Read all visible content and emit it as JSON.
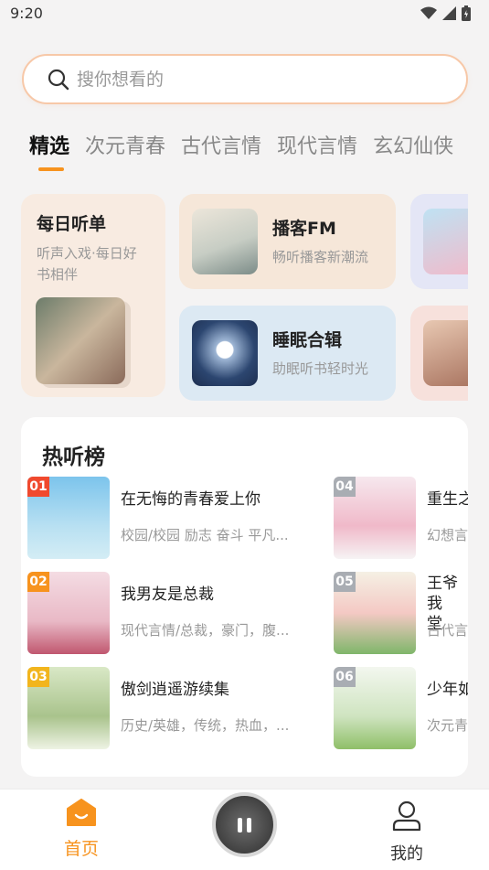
{
  "status_bar": {
    "time": "9:20",
    "icons": [
      "wifi-icon",
      "signal-icon",
      "battery-icon"
    ]
  },
  "search": {
    "placeholder": "搜你想看的",
    "icon": "search-icon"
  },
  "tabs": [
    {
      "label": "精选",
      "active": true
    },
    {
      "label": "次元青春",
      "active": false
    },
    {
      "label": "古代言情",
      "active": false
    },
    {
      "label": "现代言情",
      "active": false
    },
    {
      "label": "玄幻仙侠",
      "active": false
    }
  ],
  "featured": {
    "daily": {
      "title": "每日听单",
      "subtitle": "听声入戏·每日好书相伴"
    },
    "podcast": {
      "title": "播客FM",
      "subtitle": "畅听播客新潮流"
    },
    "sleep": {
      "title": "睡眠合辑",
      "subtitle": "助眠听书轻时光"
    }
  },
  "hot_list": {
    "title": "热听榜",
    "items": [
      {
        "rank": "01",
        "name": "在无悔的青春爱上你",
        "tags": "校园/校园 励志 奋斗 平凡..."
      },
      {
        "rank": "02",
        "name": "我男友是总裁",
        "tags": "现代言情/总裁，豪门，腹..."
      },
      {
        "rank": "03",
        "name": "傲剑逍遥游续集",
        "tags": "历史/英雄，传统，热血，..."
      },
      {
        "rank": "04",
        "name": "重生之",
        "tags": "幻想言"
      },
      {
        "rank": "05",
        "name": "王爷我\n堂",
        "tags": "古代言"
      },
      {
        "rank": "06",
        "name": "少年如",
        "tags": "次元青"
      }
    ]
  },
  "bottom_nav": {
    "home_label": "首页",
    "mine_label": "我的"
  },
  "colors": {
    "accent": "#f7931e",
    "rank1": "#f0492e",
    "rank2": "#f7931e",
    "rank3": "#f2b51d",
    "rank_other": "#a9adb3"
  }
}
